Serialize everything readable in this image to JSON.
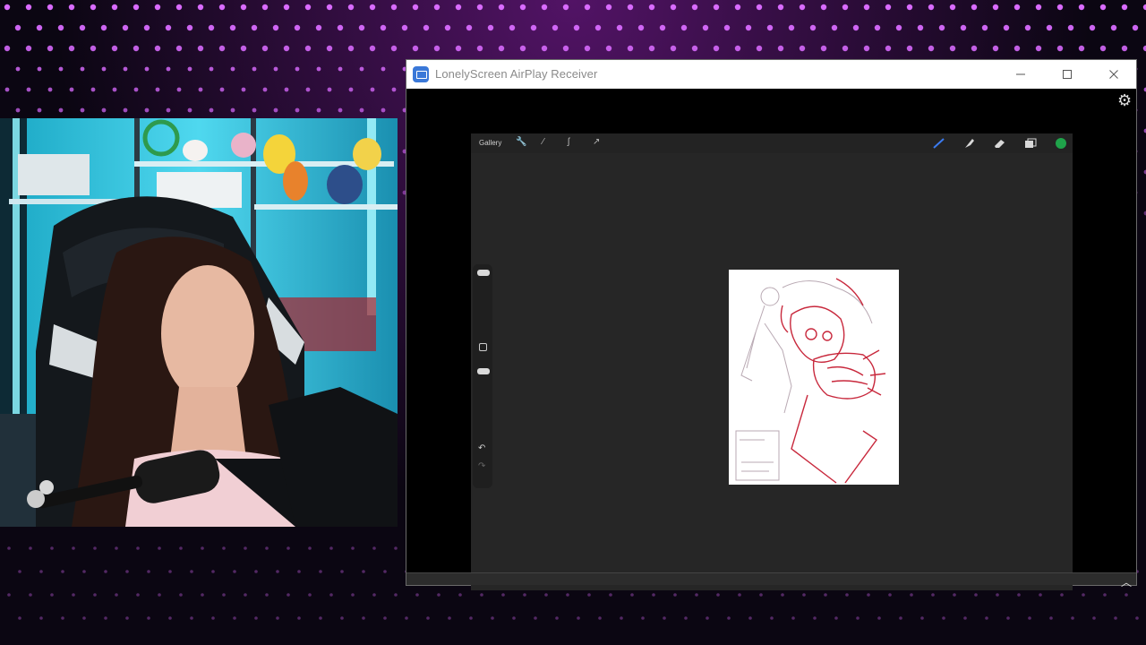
{
  "window": {
    "title": "LonelyScreen AirPlay Receiver",
    "icons": [
      "app-icon",
      "minimize-icon",
      "maximize-icon",
      "close-icon",
      "gear-icon",
      "chevron-up-icon"
    ]
  },
  "procreate": {
    "gallery_label": "Gallery",
    "left_tools": [
      "wrench-icon",
      "magic-wand-icon",
      "selection-icon",
      "transform-icon"
    ],
    "right_tools": [
      "brush-icon",
      "smudge-icon",
      "eraser-icon",
      "layers-icon"
    ],
    "active_color": "#1fa34a",
    "side_controls": [
      "brush-size-slider",
      "modify-button",
      "opacity-slider",
      "undo-icon",
      "redo-icon"
    ]
  },
  "colors": {
    "accent_light": "#d96bff",
    "sketch_red": "#c8283c"
  }
}
